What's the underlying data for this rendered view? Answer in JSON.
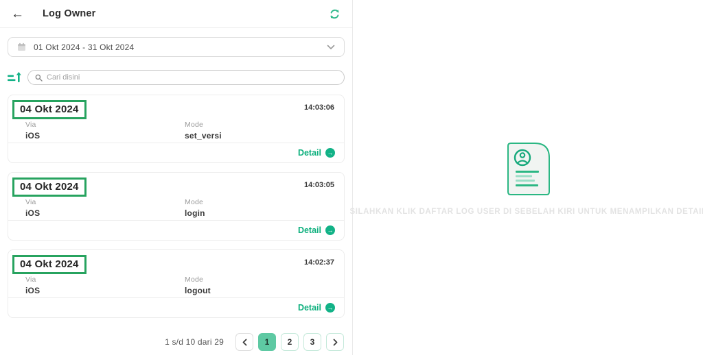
{
  "header": {
    "title": "Log Owner"
  },
  "filters": {
    "date_range": "01 Okt 2024 - 31 Okt 2024",
    "search_placeholder": "Cari disini"
  },
  "labels": {
    "via": "Via",
    "mode": "Mode",
    "detail": "Detail",
    "detail_arrow": "→",
    "back_arrow": "←"
  },
  "logs": [
    {
      "date": "04 Okt 2024",
      "time": "14:03:06",
      "via": "iOS",
      "mode": "set_versi"
    },
    {
      "date": "04 Okt 2024",
      "time": "14:03:05",
      "via": "iOS",
      "mode": "login"
    },
    {
      "date": "04 Okt 2024",
      "time": "14:02:37",
      "via": "iOS",
      "mode": "logout"
    }
  ],
  "pagination": {
    "summary": "1 s/d 10 dari 29",
    "pages": [
      "1",
      "2",
      "3"
    ],
    "active_page": "1"
  },
  "placeholder": {
    "message": "SILAHKAN KLIK DAFTAR LOG USER DI SEBELAH KIRI UNTUK MENAMPILKAN DETAIL"
  },
  "icons": {
    "back": "back-arrow",
    "refresh": "circular-arrows",
    "calendar": "calendar-grid",
    "chevron_down": "chevron-down",
    "sort": "bars-with-up-arrow",
    "search": "magnifier",
    "detail": "arrow-right-circle",
    "page_prev": "chevron-left",
    "page_next": "chevron-right",
    "empty_state": "document-with-user"
  },
  "colors": {
    "accent_green": "#12b287",
    "annotation_green": "#27a35f",
    "active_page_bg": "#5ec9a3",
    "light_green_border": "#c4e9da",
    "muted_text": "#9b9b9b",
    "empty_message_text": "#e3e3e3"
  }
}
